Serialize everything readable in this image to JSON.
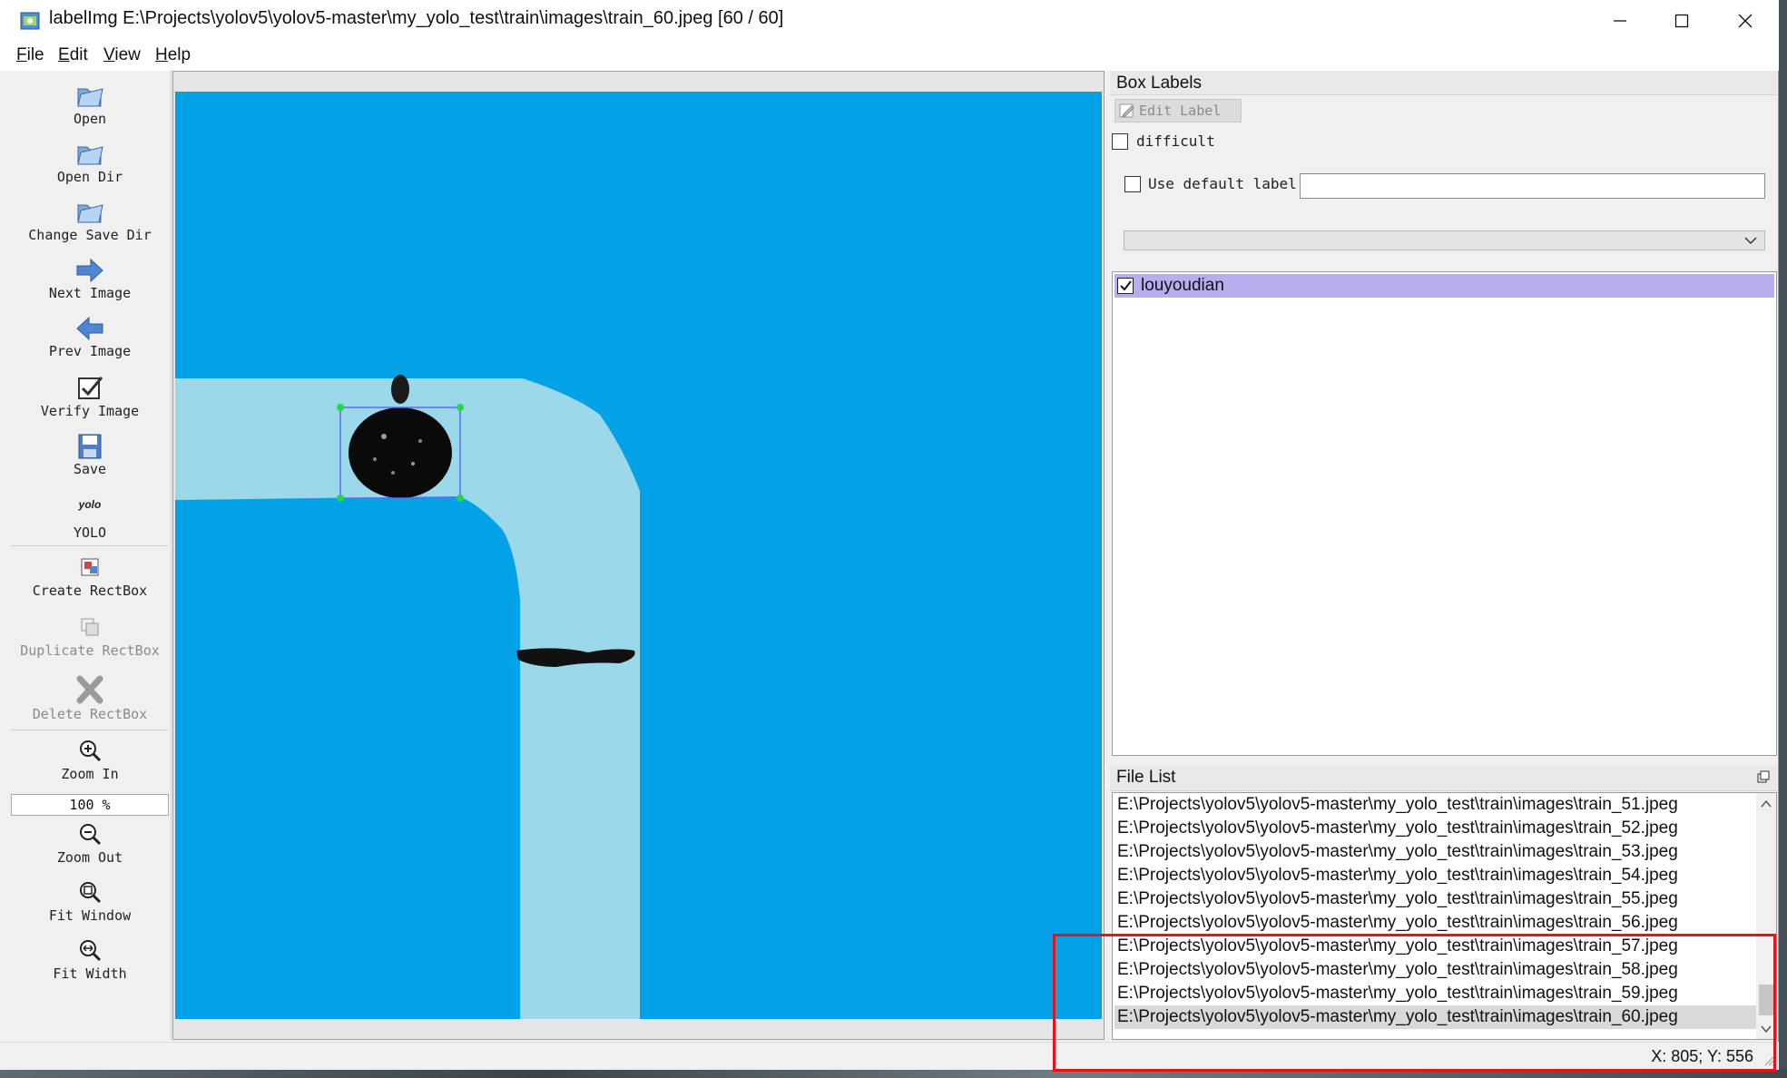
{
  "window": {
    "title": "labelImg E:\\Projects\\yolov5\\yolov5-master\\my_yolo_test\\train\\images\\train_60.jpeg [60 / 60]"
  },
  "menu": [
    {
      "label": "File"
    },
    {
      "label": "Edit"
    },
    {
      "label": "View"
    },
    {
      "label": "Help"
    }
  ],
  "toolbar": {
    "open": "Open",
    "open_dir": "Open Dir",
    "change_save_dir": "Change Save Dir",
    "next_image": "Next Image",
    "prev_image": "Prev Image",
    "verify_image": "Verify Image",
    "save": "Save",
    "format_logo": "yolo",
    "format": "YOLO",
    "create_rectbox": "Create RectBox",
    "duplicate_rectbox": "Duplicate RectBox",
    "delete_rectbox": "Delete RectBox",
    "zoom_in": "Zoom In",
    "zoom_value": "100 %",
    "zoom_out": "Zoom Out",
    "fit_window": "Fit Window",
    "fit_width": "Fit Width"
  },
  "box_labels": {
    "title": "Box Labels",
    "edit_label": "Edit Label",
    "difficult": "difficult",
    "difficult_checked": false,
    "use_default_label": "Use default label",
    "use_default_checked": false,
    "default_label_value": "",
    "labels": [
      {
        "text": "louyoudian",
        "checked": true,
        "selected": true
      }
    ]
  },
  "file_list": {
    "title": "File List",
    "files": [
      "E:\\Projects\\yolov5\\yolov5-master\\my_yolo_test\\train\\images\\train_51.jpeg",
      "E:\\Projects\\yolov5\\yolov5-master\\my_yolo_test\\train\\images\\train_52.jpeg",
      "E:\\Projects\\yolov5\\yolov5-master\\my_yolo_test\\train\\images\\train_53.jpeg",
      "E:\\Projects\\yolov5\\yolov5-master\\my_yolo_test\\train\\images\\train_54.jpeg",
      "E:\\Projects\\yolov5\\yolov5-master\\my_yolo_test\\train\\images\\train_55.jpeg",
      "E:\\Projects\\yolov5\\yolov5-master\\my_yolo_test\\train\\images\\train_56.jpeg",
      "E:\\Projects\\yolov5\\yolov5-master\\my_yolo_test\\train\\images\\train_57.jpeg",
      "E:\\Projects\\yolov5\\yolov5-master\\my_yolo_test\\train\\images\\train_58.jpeg",
      "E:\\Projects\\yolov5\\yolov5-master\\my_yolo_test\\train\\images\\train_59.jpeg",
      "E:\\Projects\\yolov5\\yolov5-master\\my_yolo_test\\train\\images\\train_60.jpeg"
    ],
    "selected_index": 9
  },
  "status": {
    "coords": "X: 805; Y: 556"
  },
  "colors": {
    "canvas_background": "#03a2e6",
    "road": "#9ad8ea",
    "bbox": "#5b6ef0",
    "bbox_handle": "#22d84a",
    "label_selected": "#b7aef0",
    "highlight": "#e8131a"
  }
}
